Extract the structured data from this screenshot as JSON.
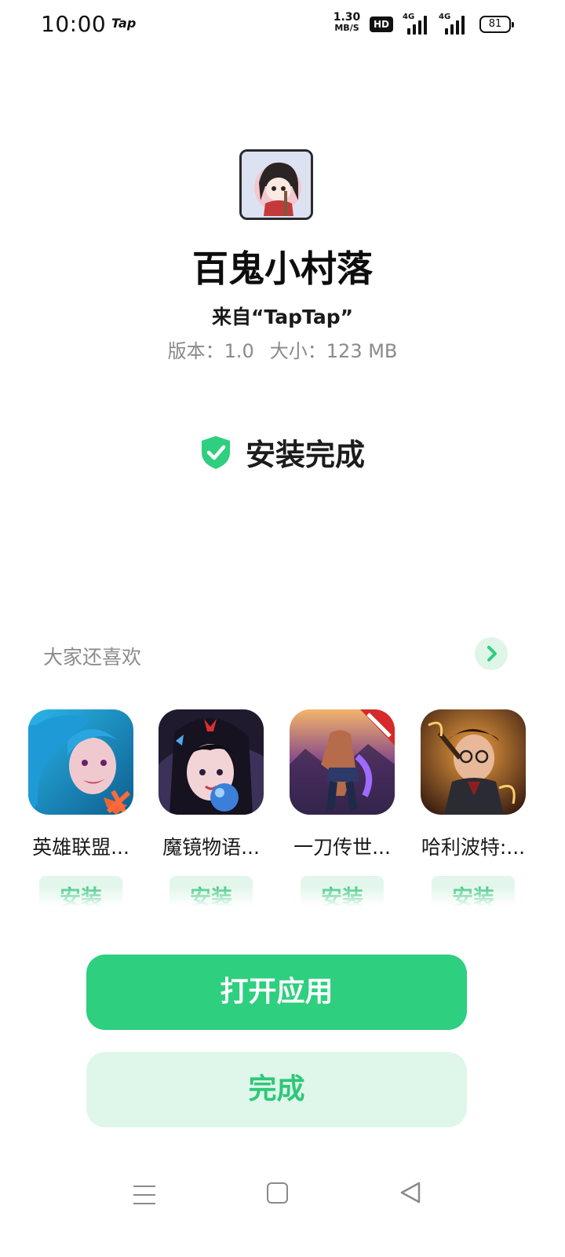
{
  "status_bar": {
    "time": "10:00",
    "notification_app": "Tap",
    "net_speed_value": "1.30",
    "net_speed_unit": "MB/S",
    "hd_label": "HD",
    "signal_1_label": "4G",
    "signal_2_label": "4G",
    "battery": "81"
  },
  "app": {
    "icon": "app-avatar-icon",
    "name": "百鬼小村落",
    "source": "来自“TapTap”",
    "version": "版本：1.0",
    "size": "大小：123 MB"
  },
  "install": {
    "status": "安装完成",
    "icon": "shield-check-icon",
    "accent": "#2ecf7e"
  },
  "recommendations": {
    "title": "大家还喜欢",
    "more_icon": "chevron-right-icon",
    "items": [
      {
        "name": "英雄联盟...",
        "install_label": "安装",
        "icon": "league-of-legends-icon"
      },
      {
        "name": "魔镜物语...",
        "install_label": "安装",
        "icon": "mirror-tales-icon"
      },
      {
        "name": "一刀传世...",
        "install_label": "安装",
        "icon": "one-blade-icon"
      },
      {
        "name": "哈利波特:...",
        "install_label": "安装",
        "icon": "harry-potter-icon"
      }
    ]
  },
  "actions": {
    "open_label": "打开应用",
    "done_label": "完成"
  },
  "nav": {
    "menu_icon": "menu-icon",
    "home_icon": "home-icon",
    "back_icon": "back-icon"
  }
}
